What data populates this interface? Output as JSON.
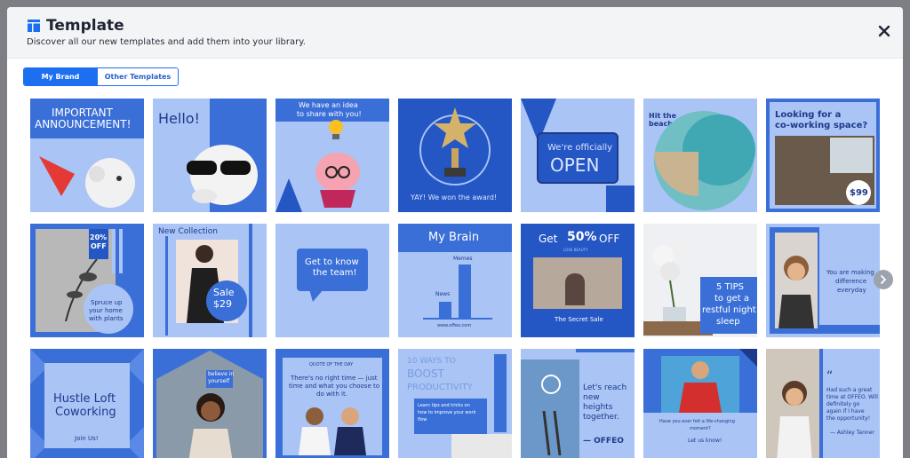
{
  "header": {
    "title": "Template",
    "subtitle": "Discover all our new templates and add them into your library."
  },
  "tabs": [
    {
      "label": "My Brand",
      "active": true
    },
    {
      "label": "Other Templates",
      "active": false
    }
  ],
  "colors": {
    "primary": "#1c6ff0",
    "card_blue": "#3b6fd8",
    "card_light": "#a9c4f5",
    "card_dark": "#2456c4"
  },
  "cards": {
    "c1": {
      "line1": "IMPORTANT",
      "line2": "ANNOUNCEMENT!"
    },
    "c2": {
      "text": "Hello!"
    },
    "c3": {
      "line1": "We have an idea",
      "line2": "to share with you!"
    },
    "c4": {
      "text": "YAY! We won the award!"
    },
    "c5": {
      "line1": "We're officially",
      "line2": "OPEN"
    },
    "c6": {
      "line1": "Hit the",
      "line2": "beach"
    },
    "c7": {
      "line1": "Looking for a",
      "line2": "co-working space?",
      "price": "$99"
    },
    "c8": {
      "badge1": "20%",
      "badge2": "OFF",
      "line1": "Spruce up",
      "line2": "your home",
      "line3": "with plants"
    },
    "c9": {
      "title": "New Collection",
      "sale": "Sale",
      "price": "$29"
    },
    "c10": {
      "line1": "Get to know",
      "line2": "the team!"
    },
    "c11": {
      "title": "My Brain",
      "bar1": "Memes",
      "bar2": "News",
      "url": "www.offeo.com"
    },
    "c12": {
      "line1": "Get",
      "pct": "50%",
      "off": "OFF",
      "small": "LOVE BEAUTY",
      "footer": "The Secret Sale"
    },
    "c13": {
      "line1": "5 TIPS",
      "line2": "to get a",
      "line3": "restful night",
      "line4": "sleep"
    },
    "c14": {
      "line1": "You are making",
      "line2": "difference",
      "line3": "everyday"
    },
    "c15": {
      "line1": "Hustle Loft",
      "line2": "Coworking",
      "cta": "Join Us!"
    },
    "c16": {
      "line1": "believe in",
      "line2": "yourself"
    },
    "c17": {
      "header": "QUOTE OF THE DAY",
      "line1": "There's no right time — just",
      "line2": "time and what you choose to",
      "line3": "do with it."
    },
    "c18": {
      "bg1": "10 WAYS TO",
      "bg2": "BOOST",
      "bg3": "PRODUCTIVITY",
      "line1": "Learn tips and tricks on",
      "line2": "how to improve your work",
      "line3": "flow"
    },
    "c19": {
      "line1": "Let's reach",
      "line2": "new",
      "line3": "heights",
      "line4": "together.",
      "brand": "— OFFEO"
    },
    "c20": {
      "line1": "Have you ever felt a life-changing",
      "line2": "moment?",
      "cta": "Let us know!"
    },
    "c21": {
      "quote": "“",
      "line1": "Had such a great",
      "line2": "time at OFFEO. Will",
      "line3": "definitely go",
      "line4": "again if I have",
      "line5": "the opportunity!",
      "author": "— Ashley Tanner"
    }
  }
}
